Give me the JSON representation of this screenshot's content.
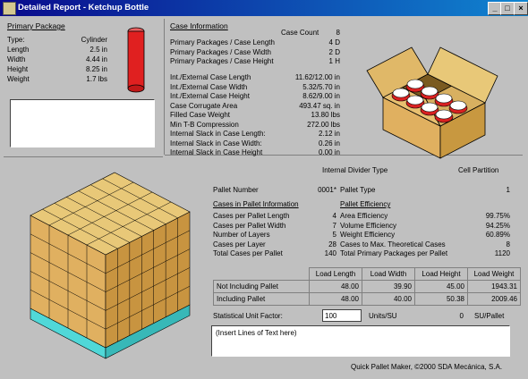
{
  "window": {
    "title": "Detailed Report - Ketchup Bottle"
  },
  "primary_package": {
    "heading": "Primary Package",
    "rows": [
      {
        "label": "Type:",
        "value": "Cylinder"
      },
      {
        "label": "Length",
        "value": "2.5 in"
      },
      {
        "label": "Width",
        "value": "4.44 in"
      },
      {
        "label": "Height",
        "value": "8.25 in"
      },
      {
        "label": "Weight",
        "value": "1.7 lbs"
      }
    ]
  },
  "case_info": {
    "heading": "Case Information",
    "case_count_label": "Case Count",
    "case_count_value": "8",
    "rows_a": [
      {
        "label": "Primary Packages / Case Length",
        "value": "4 D"
      },
      {
        "label": "Primary Packages / Case Width",
        "value": "2 D"
      },
      {
        "label": "Primary Packages / Case Height",
        "value": "1 H"
      }
    ],
    "rows_b": [
      {
        "label": "Int./External Case Length",
        "value": "11.62/12.00 in"
      },
      {
        "label": "Int./External Case Width",
        "value": "5.32/5.70 in"
      },
      {
        "label": "Int./External Case Height",
        "value": "8.62/9.00 in"
      },
      {
        "label": "Case Corrugate Area",
        "value": "493.47 sq. in"
      },
      {
        "label": "Filled Case Weight",
        "value": "13.80 lbs"
      },
      {
        "label": "Min T-B Compression",
        "value": "272.00 lbs"
      },
      {
        "label": "Internal Slack in Case Length:",
        "value": "2.12 in"
      },
      {
        "label": "Internal Slack in Case Width:",
        "value": "0.26 in"
      },
      {
        "label": "Internal Slack in Case Height",
        "value": "0.00 in"
      }
    ],
    "divider_label": "Internal Divider Type",
    "divider_value": "Cell Partition"
  },
  "pallet": {
    "number_label": "Pallet Number",
    "number_value": "0001*",
    "type_label": "Pallet Type",
    "type_value": "1",
    "cases_heading": "Cases in Pallet Information",
    "efficiency_heading": "Pallet Efficiency",
    "cases_rows": [
      {
        "label": "Cases per Pallet Length",
        "value": "4"
      },
      {
        "label": "Cases per Pallet Width",
        "value": "7"
      },
      {
        "label": "Number of Layers",
        "value": "5"
      },
      {
        "label": "Cases per Layer",
        "value": "28"
      },
      {
        "label": "Total Cases per Pallet",
        "value": "140"
      }
    ],
    "efficiency_rows": [
      {
        "label": "Area Efficiency",
        "value": "99.75%"
      },
      {
        "label": "Volume Efficiency",
        "value": "94.25%"
      },
      {
        "label": "Weight Efficiency",
        "value": "60.89%"
      },
      {
        "label": "Cases to Max. Theoretical Cases",
        "value": "8"
      },
      {
        "label": "Total Primary Packages per Pallet",
        "value": "1120"
      }
    ]
  },
  "load_table": {
    "headers": [
      "Load Length",
      "Load Width",
      "Load Height",
      "Load Weight"
    ],
    "rows": [
      {
        "label": "Not Including Pallet",
        "values": [
          "48.00",
          "39.90",
          "45.00",
          "1943.31"
        ]
      },
      {
        "label": "Including Pallet",
        "values": [
          "48.00",
          "40.00",
          "50.38",
          "2009.46"
        ]
      }
    ]
  },
  "statistical": {
    "label": "Statistical Unit Factor:",
    "value": "100",
    "units_label": "Units/SU",
    "su_value": "0",
    "su_label": "SU/Pallet"
  },
  "notes": {
    "text": "(Insert Lines of Text here)"
  },
  "footer": {
    "credit": "Quick Pallet Maker, ©2000 SDA Mecánica, S.A."
  },
  "colors": {
    "title_bar": "#0a0a8c",
    "bottle": "#e02020",
    "case": "#d8a850",
    "pallet": "#40d0d0"
  },
  "icons": [
    "app-icon",
    "minimize-icon",
    "maximize-icon",
    "close-icon"
  ]
}
